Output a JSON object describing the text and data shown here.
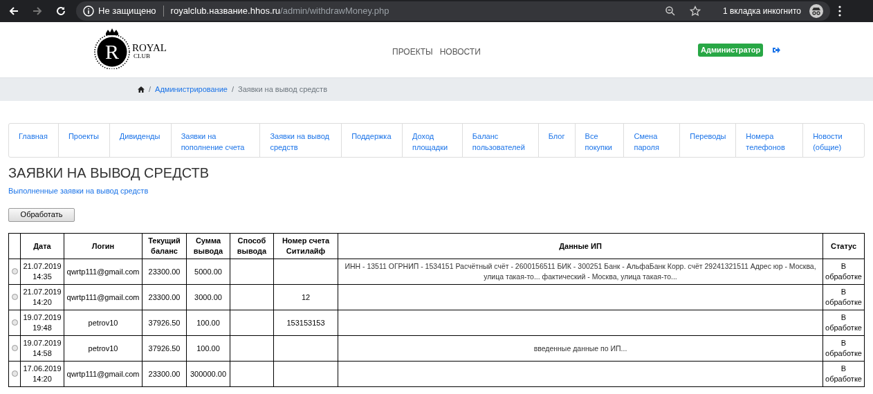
{
  "browser": {
    "security": "Не защищено",
    "url_host": "royalclub.название.hhos.ru",
    "url_path": "/admin/withdrawMoney.php",
    "back_disabled": false,
    "forward_disabled": true,
    "incognito": "1 вкладка инкогнито"
  },
  "header": {
    "logo_title": "ROYAL",
    "logo_sub": "CLUB",
    "logo_letter": "R",
    "nav": [
      "ПРОЕКТЫ",
      "НОВОСТИ"
    ],
    "role_badge": "Администратор"
  },
  "breadcrumb": {
    "separators": [
      "/",
      "/"
    ],
    "items": [
      "Администрирование"
    ],
    "current": "Заявки на вывод средств"
  },
  "tabs": [
    "Главная",
    "Проекты",
    "Дивиденды",
    "Заявки на пополнение счета",
    "Заявки на вывод средств",
    "Поддержка",
    "Доход площадки",
    "Баланс пользователей",
    "Блог",
    "Все покупки",
    "Смена пароля",
    "Переводы",
    "Номера телефонов",
    "Новости (общие)"
  ],
  "page_title": "ЗАЯВКИ НА ВЫВОД СРЕДСТВ",
  "completed_link": "Выполненные заявки на вывод средств",
  "process_button": "Обработать",
  "table": {
    "columns": [
      "Дата",
      "Логин",
      "Текущий баланс",
      "Сумма вывода",
      "Способ вывода",
      "Номер счета Ситилайф",
      "Данные ИП",
      "Статус"
    ],
    "rows": [
      {
        "selected": false,
        "cells": [
          "21.07.2019 14:35",
          "qwrtp111@gmail.com",
          "23300.00",
          "5000.00",
          "",
          "",
          "ИНН - 13511 ОГРНИП - 1534151 Расчётный счёт - 2600156511 БИК - 300251 Банк - АльфаБанк Корр. счёт 29241321511 Адрес юр - Москва, улица такая-то... фактический - Москва, улица такая-то...",
          "В обработке"
        ]
      },
      {
        "selected": false,
        "cells": [
          "21.07.2019 14:20",
          "qwrtp111@gmail.com",
          "23300.00",
          "3000.00",
          "",
          "12",
          "",
          "В обработке"
        ]
      },
      {
        "selected": false,
        "cells": [
          "19.07.2019 19:48",
          "petrov10",
          "37926.50",
          "100.00",
          "",
          "153153153",
          "",
          "В обработке"
        ]
      },
      {
        "selected": false,
        "cells": [
          "19.07.2019 14:58",
          "petrov10",
          "37926.50",
          "100.00",
          "",
          "",
          "введенные данные по ИП...",
          "В обработке"
        ]
      },
      {
        "selected": false,
        "cells": [
          "17.06.2019 14:20",
          "qwrtp111@gmail.com",
          "23300.00",
          "300000.00",
          "",
          "",
          "",
          "В обработке"
        ]
      }
    ]
  }
}
